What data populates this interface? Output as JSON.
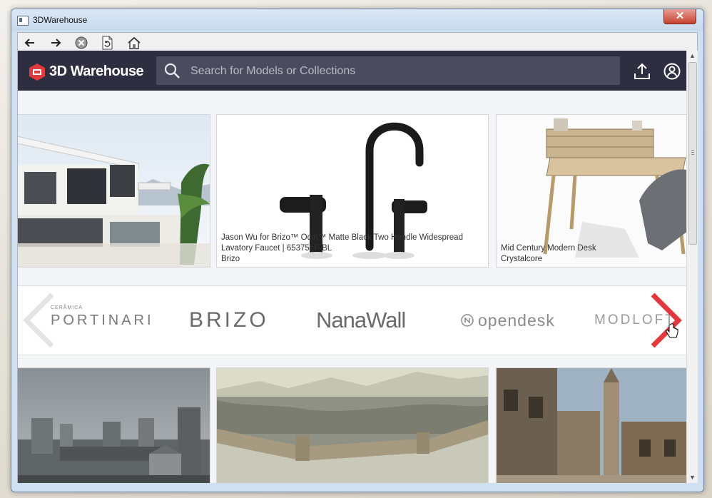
{
  "window": {
    "title": "3DWarehouse",
    "close_glyph": "✕"
  },
  "toolbar": {
    "back_icon": "arrow-left-icon",
    "forward_icon": "arrow-right-icon",
    "stop_icon": "stop-icon",
    "refresh_icon": "page-refresh-icon",
    "home_icon": "home-icon"
  },
  "header": {
    "logo_text": "3D Warehouse",
    "search_placeholder": "Search for Models or Collections",
    "upload_icon": "upload-icon",
    "account_icon": "user-icon"
  },
  "models_top": [
    {
      "name": "",
      "author": "",
      "image": "modern-villa-render"
    },
    {
      "name": "Jason Wu for Brizo™ Odin™ Matte Black Two Handle Widespread",
      "name2": "Lavatory Faucet | 65375LF-BL",
      "author": "Brizo",
      "image": "black-faucet-render"
    },
    {
      "name": "Mid Century Modern Desk",
      "author": "Crystalcore",
      "image": "wooden-desk-render"
    }
  ],
  "brands": [
    {
      "name": "PORTINARI",
      "sub": "CERÂMICA"
    },
    {
      "name": "BRIZO"
    },
    {
      "name": "NanaWall"
    },
    {
      "name": "opendesk"
    },
    {
      "name": "MODLOFT"
    }
  ],
  "carousel": {
    "prev_icon": "chevron-left-icon",
    "next_icon": "chevron-right-icon"
  },
  "models_bottom": [
    {
      "image": "castle-ruins-render"
    },
    {
      "image": "walled-city-render"
    },
    {
      "image": "old-town-street-render"
    }
  ],
  "colors": {
    "header_bg": "#2d2e40",
    "search_bg": "#4a4b5e",
    "accent_red": "#e03a3e"
  }
}
